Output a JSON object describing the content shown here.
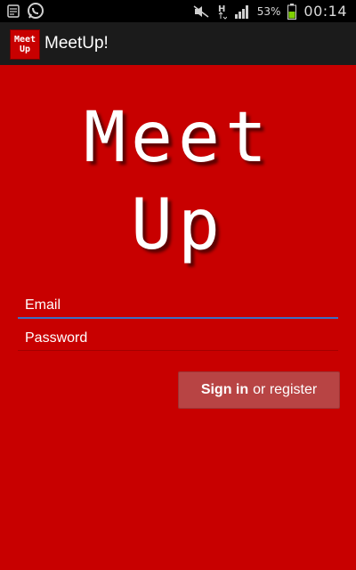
{
  "status_bar": {
    "battery_percent": "53%",
    "time": "00:14",
    "network_type": "H",
    "icons": [
      "calendar-icon",
      "whatsapp-icon",
      "mute-icon",
      "h-network-icon",
      "signal-icon",
      "battery-icon"
    ]
  },
  "action_bar": {
    "app_icon_line1": "Meet",
    "app_icon_line2": "Up",
    "title": "MeetUp!"
  },
  "logo": {
    "line1": "Meet",
    "line2": "Up"
  },
  "form": {
    "email_placeholder": "Email",
    "password_placeholder": "Password",
    "signin_label": "Sign in",
    "register_label": "or register"
  },
  "colors": {
    "background": "#c80000",
    "status_bar": "#000000",
    "action_bar": "#1b1b1b",
    "button": "#b84444",
    "email_underline": "#3b6fc4"
  }
}
